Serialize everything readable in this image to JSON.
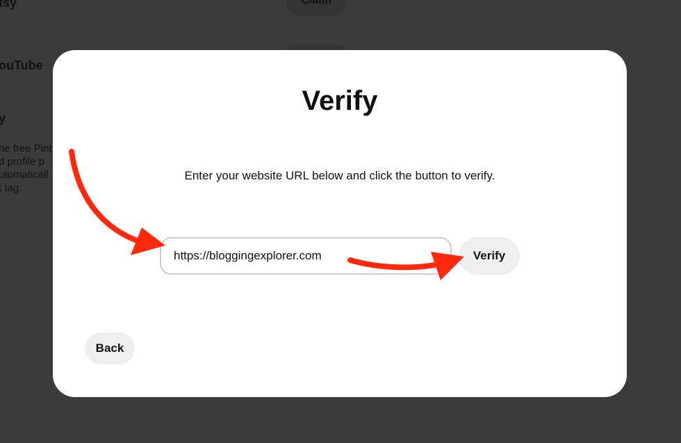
{
  "background": {
    "top_item_fragment": "tsy",
    "claim_label": "Claim",
    "youtube_fragment": "ouTube",
    "third_heading_fragment": "y",
    "description_lines": [
      "he free Pint",
      "d profile p",
      "utomaticall",
      "t tag."
    ]
  },
  "modal": {
    "title": "Verify",
    "instructions": "Enter your website URL below and click the button to verify.",
    "url_input_value": "https://bloggingexplorer.com",
    "verify_button_label": "Verify",
    "back_button_label": "Back"
  },
  "annotations": {
    "arrow_color": "#ff2a0d"
  },
  "colors": {
    "overlay": "#3b3b3b",
    "modal_background": "#ffffff",
    "button_background": "#efefef",
    "text": "#111111"
  }
}
